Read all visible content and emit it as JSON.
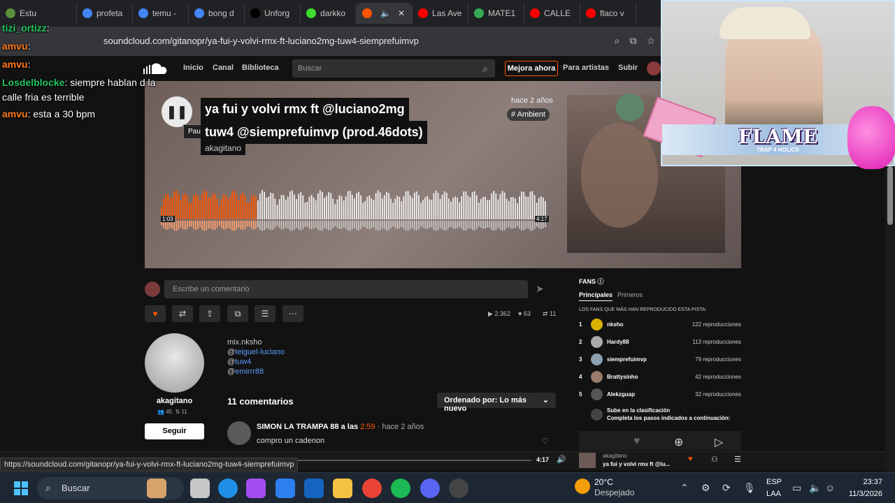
{
  "browser": {
    "tabs": [
      {
        "label": "Estu",
        "color": "#5a8f3a"
      },
      {
        "label": "profeta",
        "color": "#4285f4"
      },
      {
        "label": "temu -",
        "color": "#4285f4"
      },
      {
        "label": "bong d",
        "color": "#4285f4"
      },
      {
        "label": "Unforg",
        "color": "#000000"
      },
      {
        "label": "darkko",
        "color": "#3ddc2f"
      },
      {
        "label": "",
        "color": "#ff5500"
      },
      {
        "label": "Las Ave",
        "color": "#ff0000"
      },
      {
        "label": "MATE1",
        "color": "#34a853"
      },
      {
        "label": "CALLE",
        "color": "#ff0000"
      },
      {
        "label": "flaco v",
        "color": "#ff0000"
      }
    ],
    "url": "soundcloud.com/gitanopr/ya-fui-y-volvi-rmx-ft-luciano2mg-tuw4-siempre­fuimvp",
    "status_url": "https://soundcloud.com/gitanopr/ya-fui-y-volvi-rmx-ft-luciano2mg-tuw4-siempre­fuimvp"
  },
  "chat": [
    {
      "name": "tizi_ortizz",
      "text": ":",
      "color": "#22c55e"
    },
    {
      "name": "amvu",
      "text": ":",
      "color": "#ff7a1a"
    },
    {
      "name": "amvu",
      "text": ":",
      "color": "#ff7a1a"
    },
    {
      "name": "Losdelblocke",
      "text": ": siempre hablan d la",
      "color": "#22c55e"
    },
    {
      "name": "",
      "text": "calle fria es terrible",
      "color": "#ffffff"
    },
    {
      "name": "amvu",
      "text": ": esta a 30 bpm",
      "color": "#ff7a1a"
    }
  ],
  "webcam": {
    "banner": "FLAME",
    "banner_sub": "TRAP 4 HOLICS"
  },
  "sc": {
    "nav": [
      "Inicio",
      "Canal",
      "Biblioteca"
    ],
    "search_placeholder": "Buscar",
    "upgrade": "Mejora ahora",
    "for_artists": "Para artistas",
    "upload": "Subir"
  },
  "track": {
    "title_line1": "ya fui y volvi rmx ft @luciano2mg",
    "title_line2": "tuw4 @siempre­fuimvp (prod.46dots)",
    "artist": "akagitano",
    "posted": "hace 2 años",
    "genre": "# Ambient",
    "tooltip": "Pausar",
    "elapsed": "1:03",
    "duration": "4:17",
    "progress": 0.245
  },
  "comment_box": {
    "placeholder": "Escribe un comentario"
  },
  "stats": {
    "plays": "2.362",
    "likes": "63",
    "reposts": "11"
  },
  "uploader": {
    "name": "akagitano",
    "followers": "45",
    "tracks": "11",
    "follow": "Seguir"
  },
  "description": {
    "line1": "mix.nksho",
    "line2_prefix": "@",
    "line2_link": "teiguel-luciano",
    "line3_prefix": "@",
    "line3_link": "tuw4",
    "line4_prefix": "@",
    "line4_link": "emirrr88"
  },
  "comments": {
    "count_label": "11 comentarios",
    "sort_label": "Ordenado por: Lo más nuevo",
    "first": {
      "author": "SIMON LA TRAMPA 88 a las ",
      "time": "2:59",
      "ago": " · hace 2 años",
      "text": "compro un cadenon"
    }
  },
  "fans": {
    "title": "FANS",
    "tabs": [
      "Principales",
      "Primeros"
    ],
    "subtitle": "LOS FANS QUE MÁS HAN REPRODUCIDO ESTA PISTA:",
    "list": [
      {
        "rank": "1",
        "name": "nksho",
        "plays": "122 reproducciones",
        "color": "#d9b300"
      },
      {
        "rank": "2",
        "name": "Hardy88",
        "plays": "113 reproducciones",
        "color": "#aaaaaa"
      },
      {
        "rank": "3",
        "name": "siempre­fuimvp",
        "plays": "79 reproducciones",
        "color": "#8ca0b0"
      },
      {
        "rank": "4",
        "name": "Brattysinho",
        "plays": "42 reproducciones",
        "color": "#9a7a6a"
      },
      {
        "rank": "5",
        "name": "Alekzguap",
        "plays": "32 reproducciones",
        "color": "#555555"
      }
    ],
    "rank_note1": "Sube en la clasificación",
    "rank_note2": "Completa los pasos indicados a continuación:"
  },
  "player": {
    "duration": "4:17",
    "mini_artist": "akagitano",
    "mini_title": "ya fui y volvi rmx ft @lu..."
  },
  "taskbar": {
    "search": "Buscar",
    "temp": "20°C",
    "weather": "Despejado",
    "lang1": "ESP",
    "lang2": "LAA",
    "time": "23:37",
    "date": "11/3/2026"
  }
}
